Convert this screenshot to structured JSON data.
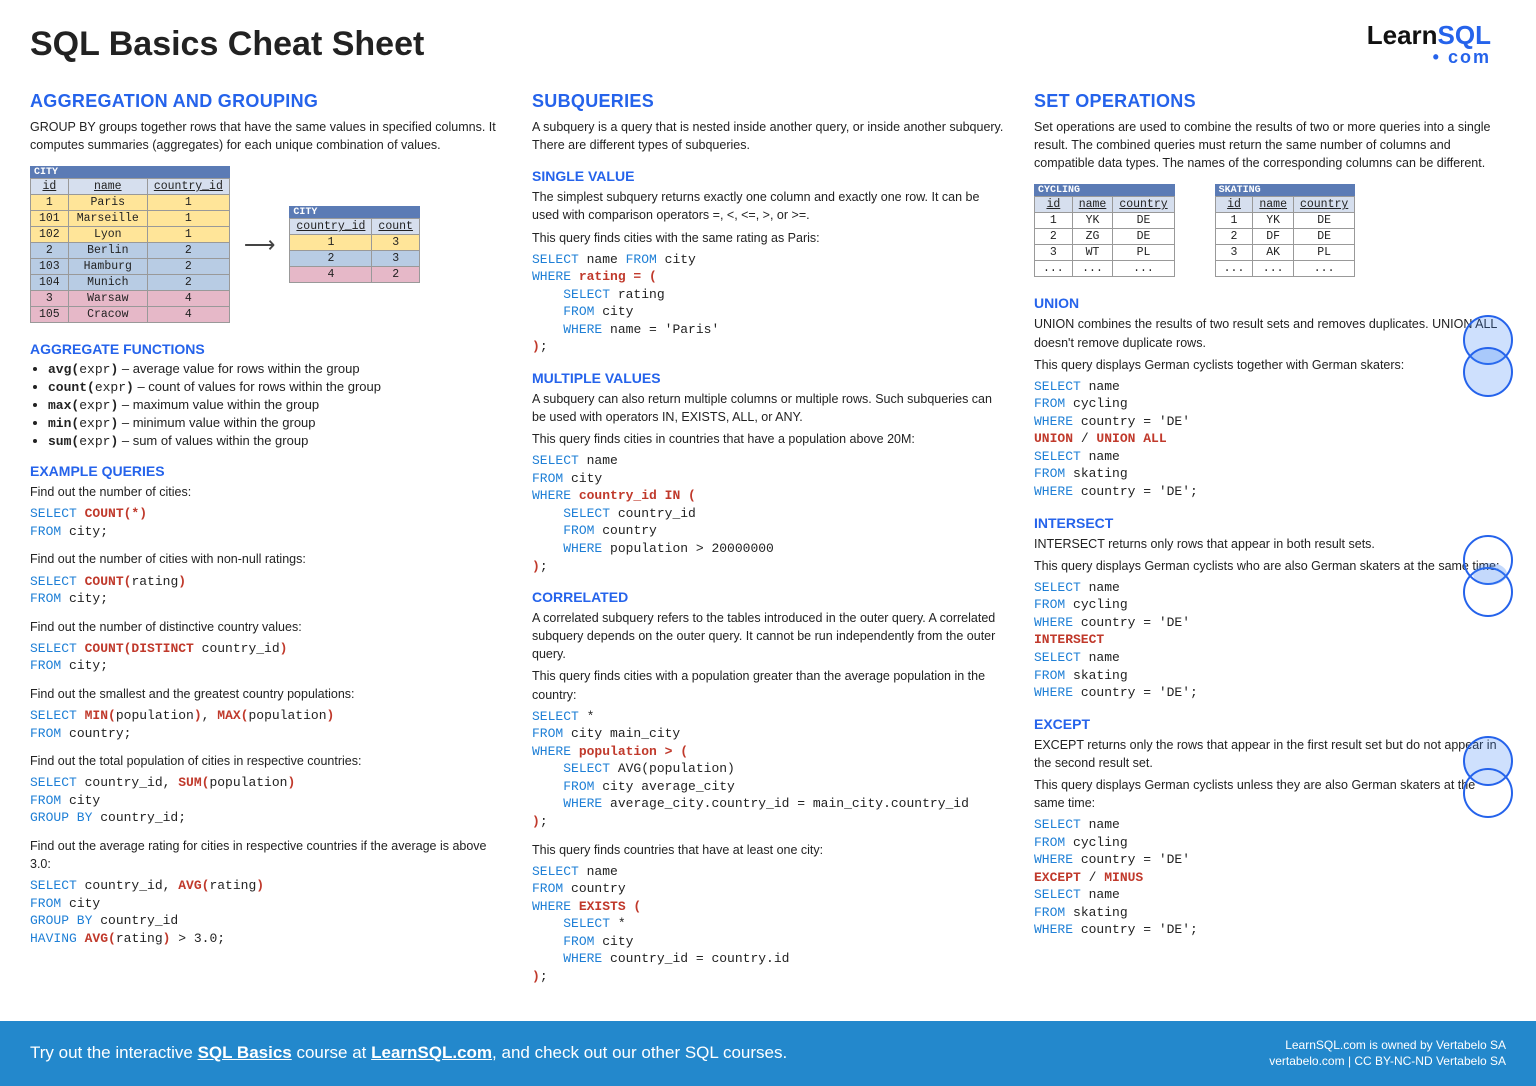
{
  "title": "SQL Basics Cheat Sheet",
  "brand": {
    "learn": "Learn",
    "sql": "SQL",
    "com": "• com"
  },
  "col1": {
    "h_agg": "AGGREGATION AND GROUPING",
    "agg_desc": "GROUP  BY groups together rows that have the same values in specified columns. It computes summaries (aggregates) for each unique combination of values.",
    "city_table": {
      "caption": "CITY",
      "headers": [
        "id",
        "name",
        "country_id"
      ],
      "rows": [
        {
          "class": "ryellow",
          "cells": [
            "1",
            "Paris",
            "1"
          ]
        },
        {
          "class": "ryellow",
          "cells": [
            "101",
            "Marseille",
            "1"
          ]
        },
        {
          "class": "ryellow",
          "cells": [
            "102",
            "Lyon",
            "1"
          ]
        },
        {
          "class": "rblue",
          "cells": [
            "2",
            "Berlin",
            "2"
          ]
        },
        {
          "class": "rblue",
          "cells": [
            "103",
            "Hamburg",
            "2"
          ]
        },
        {
          "class": "rblue",
          "cells": [
            "104",
            "Munich",
            "2"
          ]
        },
        {
          "class": "rpink",
          "cells": [
            "3",
            "Warsaw",
            "4"
          ]
        },
        {
          "class": "rpink",
          "cells": [
            "105",
            "Cracow",
            "4"
          ]
        }
      ]
    },
    "agg_result": {
      "caption": "CITY",
      "headers": [
        "country_id",
        "count"
      ],
      "rows": [
        {
          "class": "ryellow",
          "cells": [
            "1",
            "3"
          ]
        },
        {
          "class": "rblue",
          "cells": [
            "2",
            "3"
          ]
        },
        {
          "class": "rpink",
          "cells": [
            "4",
            "2"
          ]
        }
      ]
    },
    "h_funcs": "AGGREGATE FUNCTIONS",
    "funcs": [
      {
        "f": "avg(",
        "a": "expr",
        "t": ") – average value for rows within the group"
      },
      {
        "f": "count(",
        "a": "expr",
        "t": ") – count of values for rows within the group"
      },
      {
        "f": "max(",
        "a": "expr",
        "t": ") – maximum value within the group"
      },
      {
        "f": "min(",
        "a": "expr",
        "t": ") – minimum value within the group"
      },
      {
        "f": "sum(",
        "a": "expr",
        "t": ") – sum of values within the group"
      }
    ],
    "h_ex": "EXAMPLE QUERIES",
    "ex": [
      {
        "d": "Find out the number of cities:",
        "q": "<span class='kw'>SELECT</span> <span class='kr'>COUNT(*)</span>\n<span class='kw'>FROM</span> city;"
      },
      {
        "d": "Find out the number of cities with non-null ratings:",
        "q": "<span class='kw'>SELECT</span> <span class='kr'>COUNT(</span>rating<span class='kr'>)</span>\n<span class='kw'>FROM</span> city;"
      },
      {
        "d": "Find out the number of distinctive country values:",
        "q": "<span class='kw'>SELECT</span> <span class='kr'>COUNT(DISTINCT</span> country_id<span class='kr'>)</span>\n<span class='kw'>FROM</span> city;"
      },
      {
        "d": "Find out the smallest and the greatest country populations:",
        "q": "<span class='kw'>SELECT</span> <span class='kr'>MIN(</span>population<span class='kr'>)</span>, <span class='kr'>MAX(</span>population<span class='kr'>)</span>\n<span class='kw'>FROM</span> country;"
      },
      {
        "d": "Find out the total population of cities in respective countries:",
        "q": "<span class='kw'>SELECT</span> country_id, <span class='kr'>SUM(</span>population<span class='kr'>)</span>\n<span class='kw'>FROM</span> city\n<span class='kw'>GROUP BY</span> country_id;"
      },
      {
        "d": "Find out the average rating for cities in respective countries if the average is above 3.0:",
        "q": "<span class='kw'>SELECT</span> country_id, <span class='kr'>AVG(</span>rating<span class='kr'>)</span>\n<span class='kw'>FROM</span> city\n<span class='kw'>GROUP BY</span> country_id\n<span class='kw'>HAVING</span> <span class='kr'>AVG(</span>rating<span class='kr'>)</span> > 3.0;"
      }
    ]
  },
  "col2": {
    "h_sub": "SUBQUERIES",
    "sub_desc": "A subquery is a query that is nested inside another query, or inside another subquery. There are different types of subqueries.",
    "h_single": "SINGLE VALUE",
    "single_desc": "The simplest subquery returns exactly one column and exactly one row. It can be used with comparison operators =, <, <=, >, or >=.",
    "single_lead": "This query finds cities with the same rating as Paris:",
    "single_q": "<span class='kw'>SELECT</span> name <span class='kw'>FROM</span> city\n<span class='kw'>WHERE</span> <span class='kr'>rating = (</span>\n    <span class='kw'>SELECT</span> rating\n    <span class='kw'>FROM</span> city\n    <span class='kw'>WHERE</span> name = 'Paris'\n<span class='kr'>)</span>;",
    "h_multi": "MULTIPLE VALUES",
    "multi_desc": "A subquery can also return multiple columns or multiple rows. Such subqueries can be used with operators IN, EXISTS, ALL, or ANY.",
    "multi_lead": "This query finds cities in countries that have a population above 20M:",
    "multi_q": "<span class='kw'>SELECT</span> name\n<span class='kw'>FROM</span> city\n<span class='kw'>WHERE</span> <span class='kr'>country_id IN (</span>\n    <span class='kw'>SELECT</span> country_id\n    <span class='kw'>FROM</span> country\n    <span class='kw'>WHERE</span> population > 20000000\n<span class='kr'>)</span>;",
    "h_corr": "CORRELATED",
    "corr_desc": "A correlated subquery refers to the tables introduced in the outer query. A correlated subquery depends on the outer query. It cannot be run independently from the outer query.",
    "corr_lead": "This query finds cities with a population greater than the average population in the country:",
    "corr_q": "<span class='kw'>SELECT</span> *\n<span class='kw'>FROM</span> city main_city\n<span class='kw'>WHERE</span> <span class='kr'>population > (</span>\n    <span class='kw'>SELECT</span> AVG(population)\n    <span class='kw'>FROM</span> city average_city\n    <span class='kw'>WHERE</span> average_city.country_id = main_city.country_id\n<span class='kr'>)</span>;",
    "corr2_lead": "This query finds countries that have at least one city:",
    "corr2_q": "<span class='kw'>SELECT</span> name\n<span class='kw'>FROM</span> country\n<span class='kw'>WHERE</span> <span class='kr'>EXISTS (</span>\n    <span class='kw'>SELECT</span> *\n    <span class='kw'>FROM</span> city\n    <span class='kw'>WHERE</span> country_id = country.id\n<span class='kr'>)</span>;"
  },
  "col3": {
    "h_set": "SET OPERATIONS",
    "set_desc": "Set operations are used to combine the results of two or more queries into a single result. The combined queries must return the same number of columns and compatible data types. The names of the corresponding columns can be different.",
    "cycling": {
      "caption": "CYCLING",
      "headers": [
        "id",
        "name",
        "country"
      ],
      "rows": [
        [
          "1",
          "YK",
          "DE"
        ],
        [
          "2",
          "ZG",
          "DE"
        ],
        [
          "3",
          "WT",
          "PL"
        ],
        [
          "...",
          "...",
          "..."
        ]
      ]
    },
    "skating": {
      "caption": "SKATING",
      "headers": [
        "id",
        "name",
        "country"
      ],
      "rows": [
        [
          "1",
          "YK",
          "DE"
        ],
        [
          "2",
          "DF",
          "DE"
        ],
        [
          "3",
          "AK",
          "PL"
        ],
        [
          "...",
          "...",
          "..."
        ]
      ]
    },
    "h_union": "UNION",
    "union_desc": "UNION combines the results of two result sets and removes duplicates. UNION  ALL doesn't remove duplicate rows.",
    "union_lead": "This query displays German cyclists together with German skaters:",
    "union_q": "<span class='kw'>SELECT</span> name\n<span class='kw'>FROM</span> cycling\n<span class='kw'>WHERE</span> country = 'DE'\n<span class='kr'>UNION</span> / <span class='kr'>UNION ALL</span>\n<span class='kw'>SELECT</span> name\n<span class='kw'>FROM</span> skating\n<span class='kw'>WHERE</span> country = 'DE';",
    "h_intersect": "INTERSECT",
    "intersect_desc": "INTERSECT returns only rows that appear in both result sets.",
    "intersect_lead": "This query displays German cyclists who are also German skaters at the same time:",
    "intersect_q": "<span class='kw'>SELECT</span> name\n<span class='kw'>FROM</span> cycling\n<span class='kw'>WHERE</span> country = 'DE'\n<span class='kr'>INTERSECT</span>\n<span class='kw'>SELECT</span> name\n<span class='kw'>FROM</span> skating\n<span class='kw'>WHERE</span> country = 'DE';",
    "h_except": "EXCEPT",
    "except_desc": "EXCEPT returns only the rows that appear in the first result set but do not appear in the second result set.",
    "except_lead": "This query displays German cyclists unless they are also German skaters at the same time:",
    "except_q": "<span class='kw'>SELECT</span> name\n<span class='kw'>FROM</span> cycling\n<span class='kw'>WHERE</span> country = 'DE'\n<span class='kr'>EXCEPT</span> / <span class='kr'>MINUS</span>\n<span class='kw'>SELECT</span> name\n<span class='kw'>FROM</span> skating\n<span class='kw'>WHERE</span> country = 'DE';"
  },
  "footer": {
    "text_pre": "Try out the interactive ",
    "link1": "SQL Basics",
    "text_mid": " course at ",
    "link2": "LearnSQL.com",
    "text_post": ", and check out our other SQL courses.",
    "owner": "LearnSQL.com is owned by Vertabelo SA",
    "lic": "vertabelo.com | CC BY-NC-ND Vertabelo SA"
  }
}
